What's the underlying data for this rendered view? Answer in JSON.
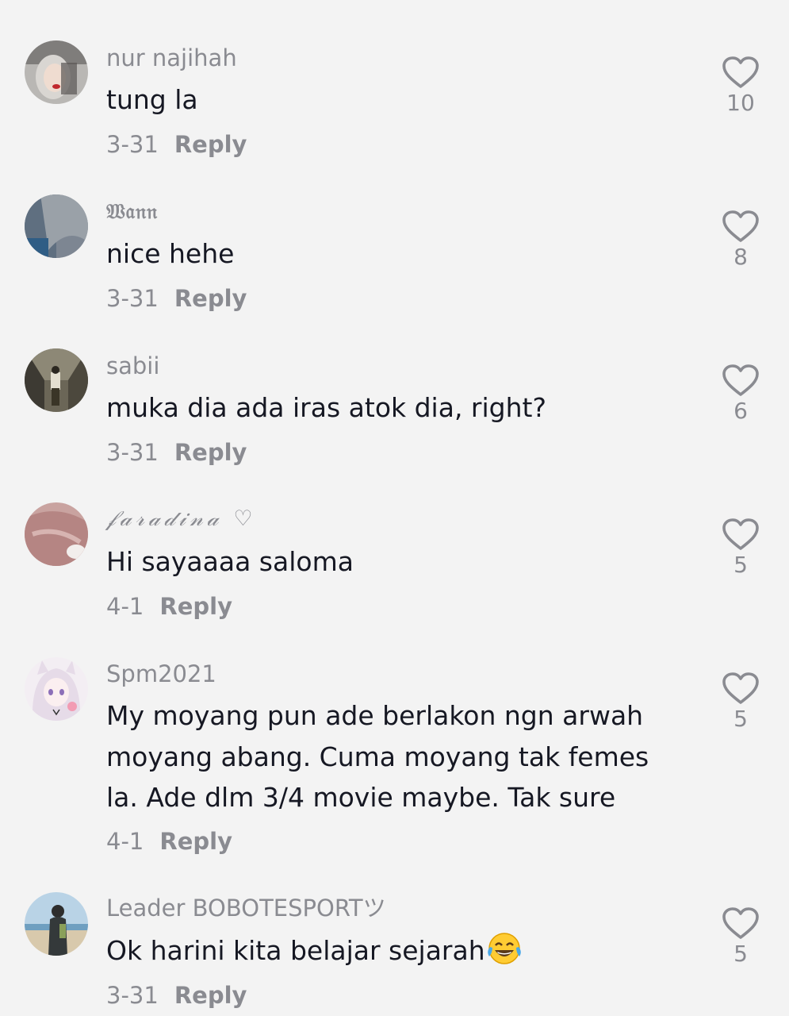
{
  "comments": [
    {
      "username": "nur najihah",
      "text": "tung la",
      "date": "3-31",
      "reply_label": "Reply",
      "likes": "10",
      "avatar_icon": "hijab-selfie-avatar"
    },
    {
      "username": "𝔚𝔞𝔫𝔫",
      "text": "nice hehe",
      "date": "3-31",
      "reply_label": "Reply",
      "likes": "8",
      "avatar_icon": "grey-blue-avatar"
    },
    {
      "username": "sabii",
      "text": "muka dia ada iras atok dia, right?",
      "date": "3-31",
      "reply_label": "Reply",
      "likes": "6",
      "avatar_icon": "warehouse-photo-avatar"
    },
    {
      "username": "𝒻𝒶𝓇𝒶𝒹𝒾𝓃𝒶 ♡",
      "text": "Hi sayaaaa saloma",
      "date": "4-1",
      "reply_label": "Reply",
      "likes": "5",
      "avatar_icon": "pink-fabric-avatar"
    },
    {
      "username": "Spm2021",
      "text_lines": [
        "My moyang pun ade berlakon ngn arwah",
        "moyang abang. Cuma moyang tak femes",
        "la. Ade dlm 3/4 movie maybe. Tak sure"
      ],
      "date": "4-1",
      "reply_label": "Reply",
      "likes": "5",
      "avatar_icon": "anime-girl-avatar"
    },
    {
      "username": "Leader BOBOTESPORTツ",
      "text": "Ok harini kita belajar sejarah",
      "emoji": "😂",
      "date": "3-31",
      "reply_label": "Reply",
      "likes": "5",
      "avatar_icon": "beach-photo-avatar"
    }
  ],
  "icons": {
    "like": "heart-outline-icon",
    "emoji": "tears-of-joy-emoji"
  },
  "colors": {
    "background": "#f3f3f3",
    "text": "#161823",
    "secondary": "#8a8b91"
  }
}
